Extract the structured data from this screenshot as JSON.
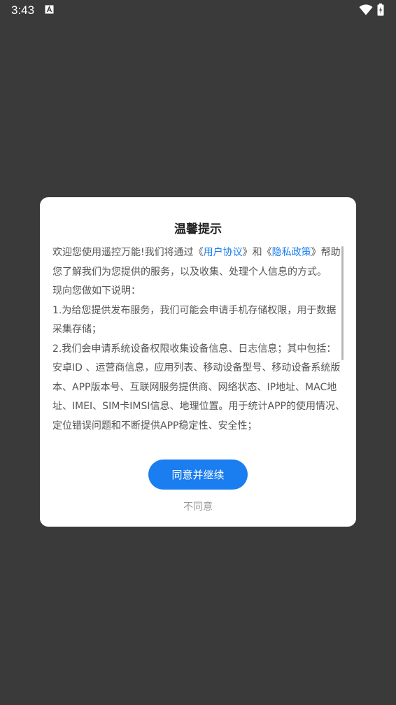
{
  "status_bar": {
    "time": "3:43",
    "notification_icon": "a-box-icon",
    "wifi_icon": "wifi-icon",
    "battery_icon": "battery-charging-icon"
  },
  "dialog": {
    "title": "温馨提示",
    "intro_prefix": "欢迎您使用遥控万能!我们将通过《",
    "user_agreement_link": "用户协议",
    "intro_mid": "》和《",
    "privacy_policy_link": "隐私政策",
    "intro_suffix": "》帮助您了解我们为您提供的服务，以及收集、处理个人信息的方式。",
    "lines": [
      "现向您做如下说明：",
      "1.为给您提供发布服务，我们可能会申请手机存储权限，用于数据采集存储；",
      "2.我们会申请系统设备权限收集设备信息、日志信息；其中包括：安卓ID 、运营商信息，应用列表、移动设备型号、移动设备系统版本、APP版本号、互联网服务提供商、网络状态、IP地址、MAC地址、IMEI、SIM卡IMSI信息、地理位置。用于统计APP的使用情况、定位错误问题和不断提供APP稳定性、安全性；"
    ],
    "agree_button": "同意并继续",
    "disagree_button": "不同意"
  },
  "colors": {
    "background": "#3a3a3a",
    "accent": "#1a7df0"
  }
}
